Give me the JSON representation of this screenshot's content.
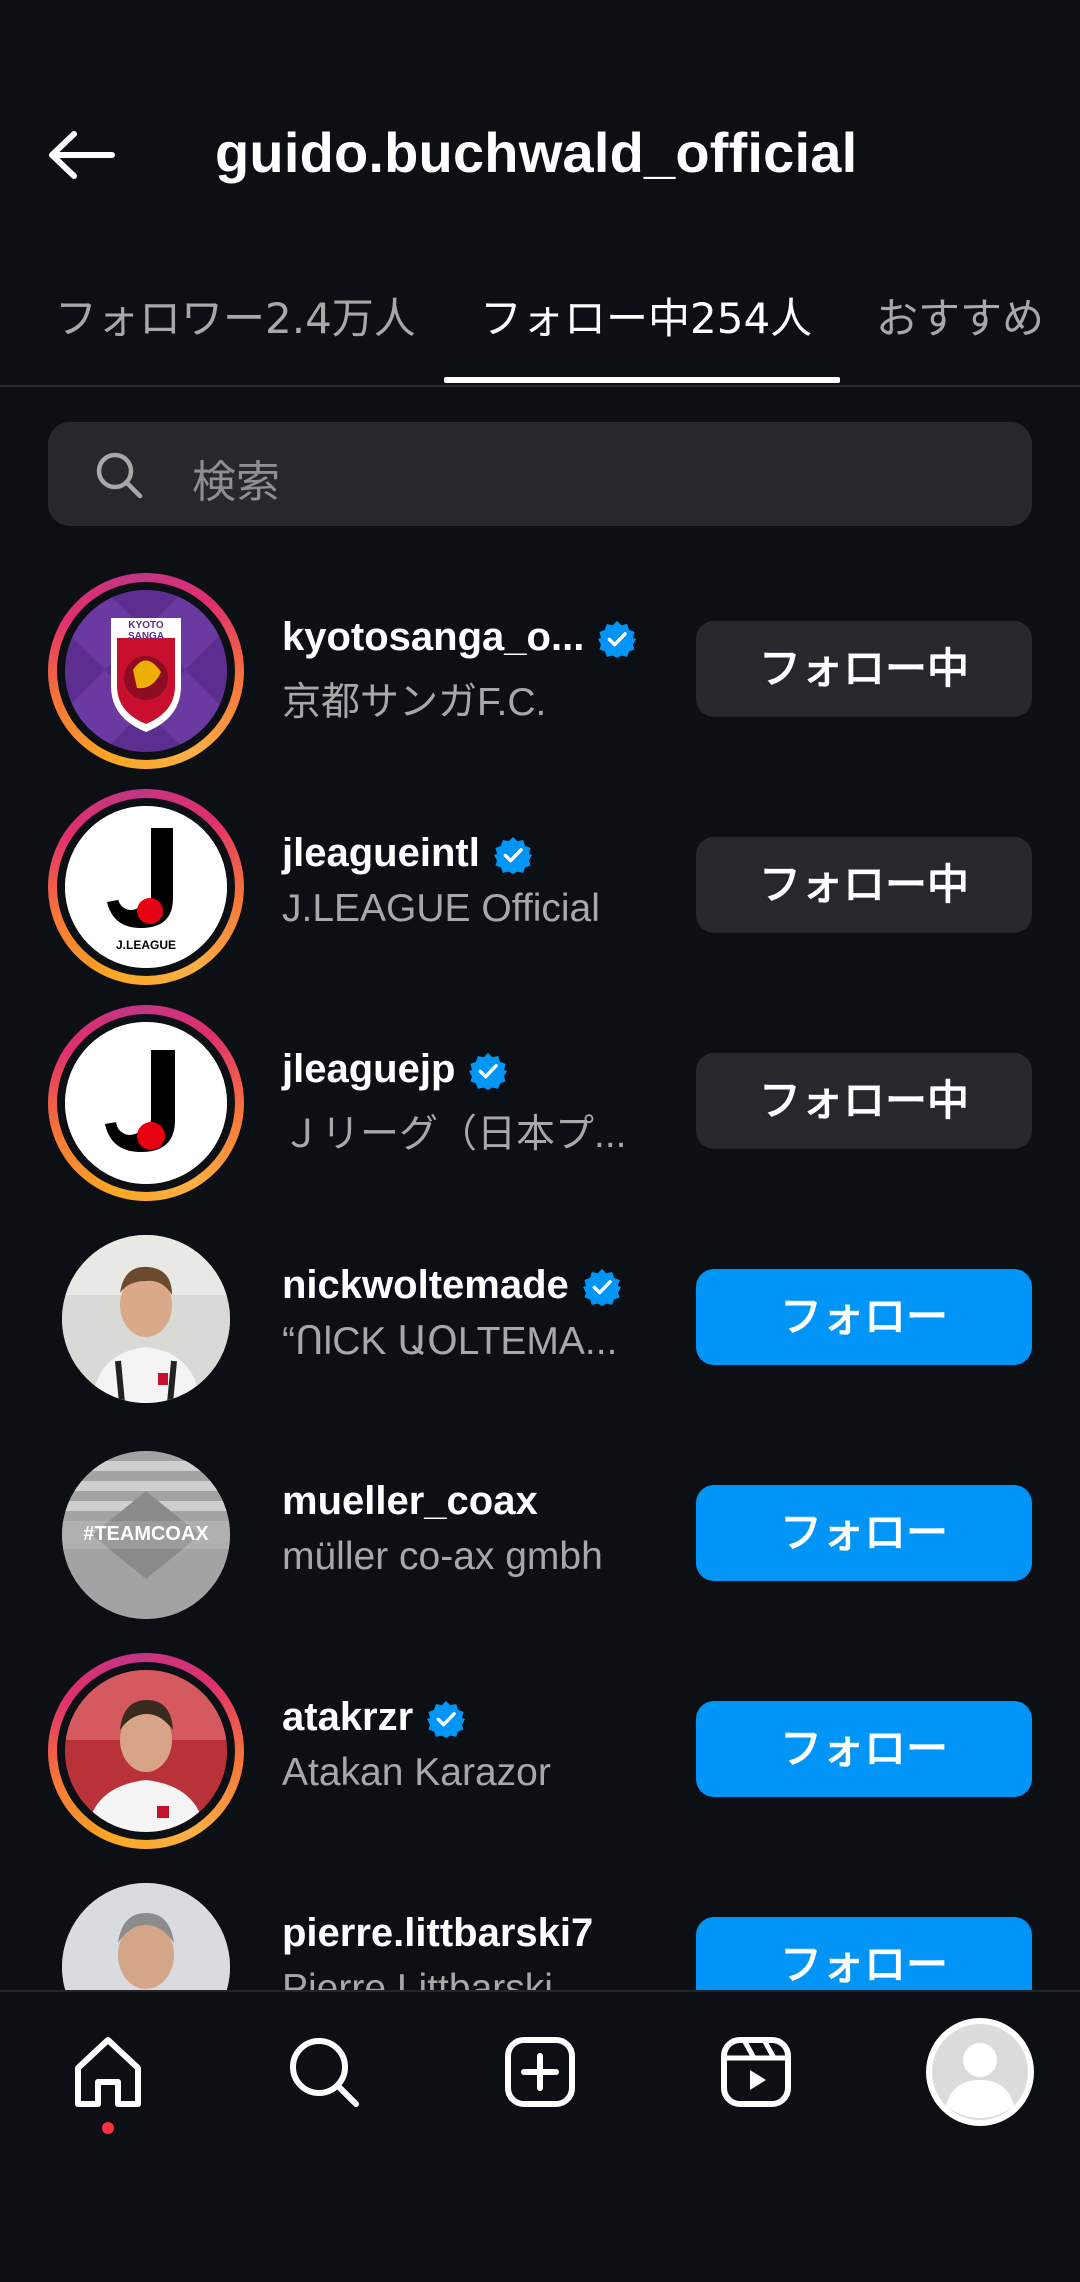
{
  "header": {
    "title": "guido.buchwald_official"
  },
  "tabs": [
    {
      "label": "フォロワー2.4万人"
    },
    {
      "label": "フォロー中254人"
    },
    {
      "label": "おすすめ"
    }
  ],
  "search": {
    "placeholder": "検索"
  },
  "accounts": [
    {
      "username": "kyotosanga_o...",
      "subtitle": "京都サンガF.C.",
      "verified": true,
      "button": "フォロー中"
    },
    {
      "username": "jleagueintl",
      "subtitle": "J.LEAGUE Official",
      "verified": true,
      "button": "フォロー中"
    },
    {
      "username": "jleaguejp",
      "subtitle": "Ｊリーグ（日本プ...",
      "verified": true,
      "button": "フォロー中"
    },
    {
      "username": "nickwoltemade",
      "subtitle": "“ՈlCK ԱՕLTEMA...",
      "verified": true,
      "button": "フォロー"
    },
    {
      "username": "mueller_coax",
      "subtitle": "müller co-ax gmbh",
      "verified": false,
      "button": "フォロー"
    },
    {
      "username": "atakrzr",
      "subtitle": "Atakan Karazor",
      "verified": true,
      "button": "フォロー"
    },
    {
      "username": "pierre.littbarski7",
      "subtitle": "Pierre Littbarski",
      "verified": false,
      "button": "フォロー"
    }
  ],
  "logos": {
    "kyoto_text": "KYOTO SANGA",
    "jleague_text": "J.LEAGUE",
    "coax_text": "#TEAMCOAX"
  },
  "colors": {
    "accent": "#0095f6",
    "background": "#0c0f14",
    "button_secondary": "#25282d",
    "verified": "#0095f6"
  }
}
